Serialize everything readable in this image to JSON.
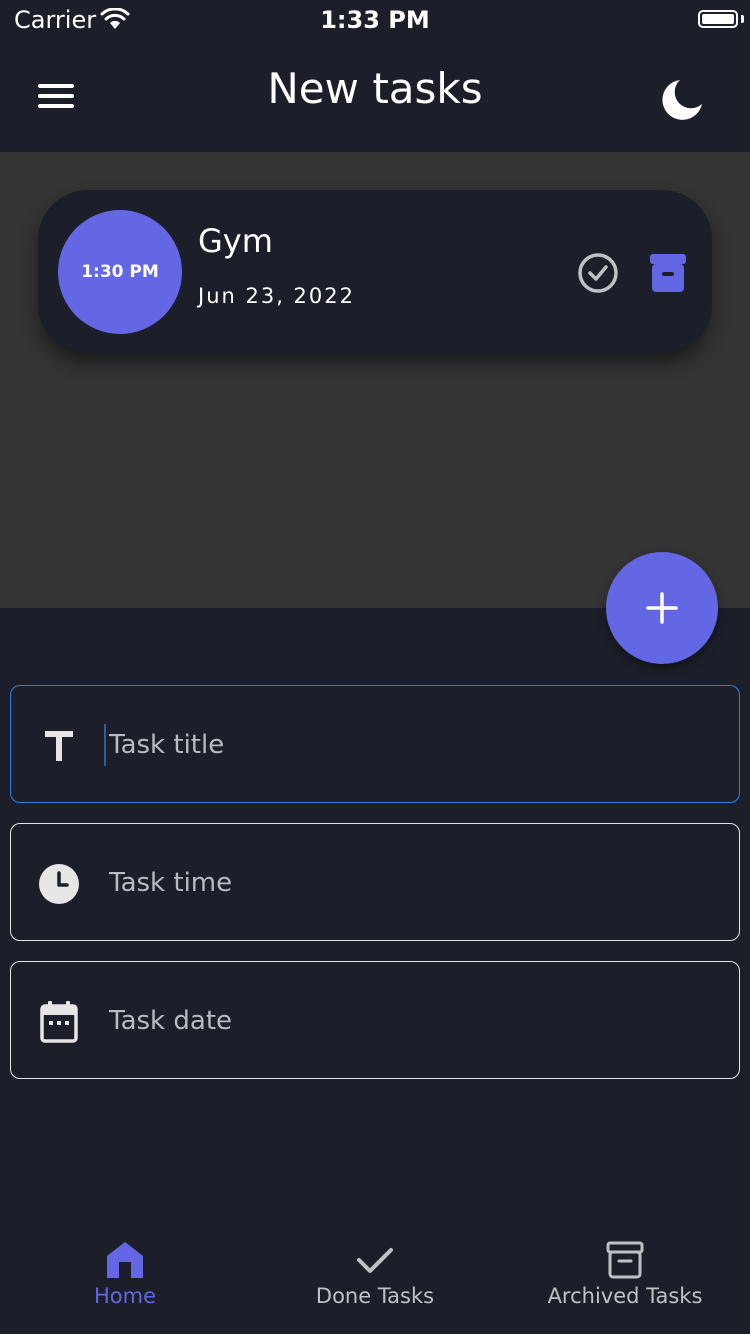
{
  "status_bar": {
    "carrier": "Carrier",
    "time": "1:33 PM"
  },
  "app_bar": {
    "title": "New tasks",
    "menu_icon": "menu-icon",
    "theme_icon": "moon-icon"
  },
  "tasks": [
    {
      "time": "1:30 PM",
      "title": "Gym",
      "date": "Jun 23, 2022",
      "done_icon": "check-circle-icon",
      "archive_icon": "archive-icon"
    }
  ],
  "fab": {
    "icon": "plus-icon"
  },
  "form": {
    "title_field": {
      "placeholder": "Task title",
      "value": "",
      "icon": "title-icon"
    },
    "time_field": {
      "placeholder": "Task time",
      "value": "",
      "icon": "clock-icon"
    },
    "date_field": {
      "placeholder": "Task date",
      "value": "",
      "icon": "calendar-icon"
    }
  },
  "bottom_nav": {
    "items": [
      {
        "label": "Home",
        "icon": "home-icon",
        "active": true
      },
      {
        "label": "Done Tasks",
        "icon": "check-icon",
        "active": false
      },
      {
        "label": "Archived Tasks",
        "icon": "archive-icon",
        "active": false
      }
    ]
  },
  "colors": {
    "accent": "#6467e3",
    "background": "#1c1f29",
    "list_background": "#343434",
    "focus_border": "#2f7fe0"
  }
}
